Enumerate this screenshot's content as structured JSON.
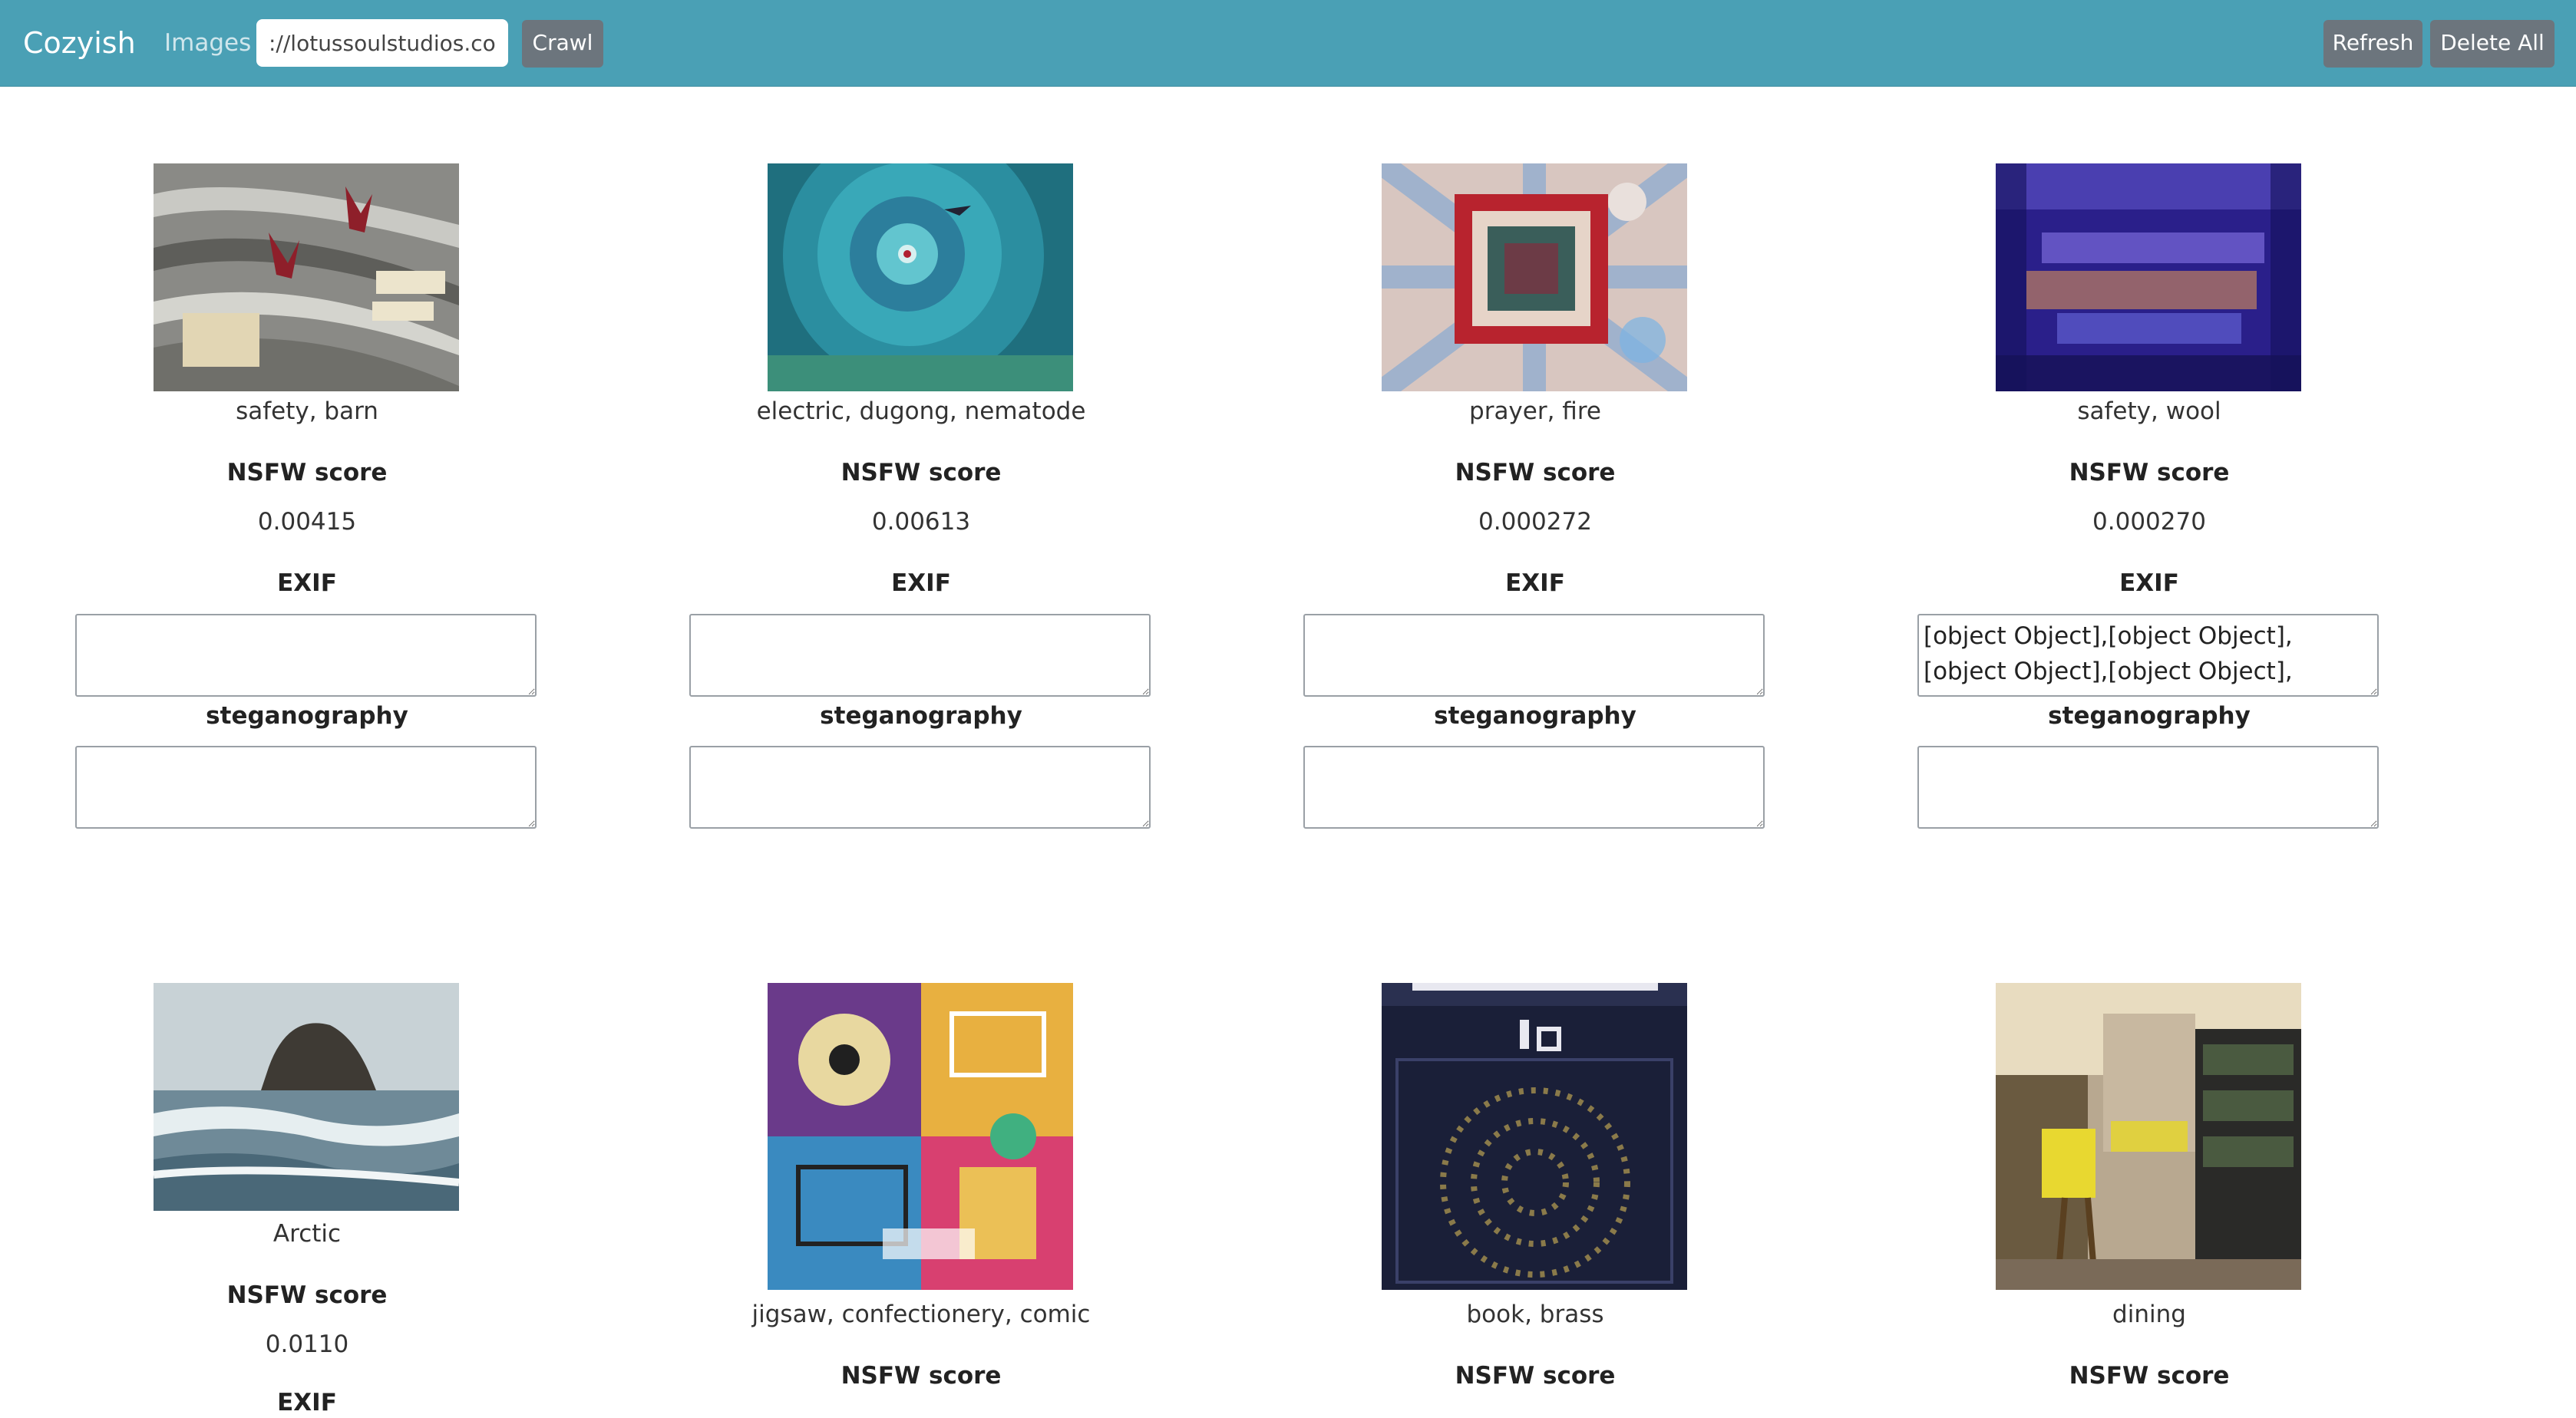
{
  "navbar": {
    "brand": "Cozyish",
    "images_link": "Images",
    "url_value": "://lotussoulstudios.com",
    "crawl_label": "Crawl",
    "refresh_label": "Refresh",
    "delete_all_label": "Delete All",
    "color": "#4aa0b5"
  },
  "labels": {
    "nsfw": "NSFW score",
    "exif": "EXIF",
    "steg": "steganography"
  },
  "cards": [
    {
      "tags": "safety, barn",
      "nsfw": "0.00415",
      "exif": "",
      "steg": ""
    },
    {
      "tags": "electric, dugong, nematode",
      "nsfw": "0.00613",
      "exif": "",
      "steg": ""
    },
    {
      "tags": "prayer, fire",
      "nsfw": "0.000272",
      "exif": "",
      "steg": ""
    },
    {
      "tags": "safety, wool",
      "nsfw": "0.000270",
      "exif": "[object Object],[object Object],[object Object],[object Object],[object Object],",
      "steg": ""
    },
    {
      "tags": "Arctic",
      "nsfw": "0.0110"
    },
    {
      "tags": "jigsaw, confectionery, comic"
    },
    {
      "tags": "book, brass"
    },
    {
      "tags": "dining"
    }
  ]
}
